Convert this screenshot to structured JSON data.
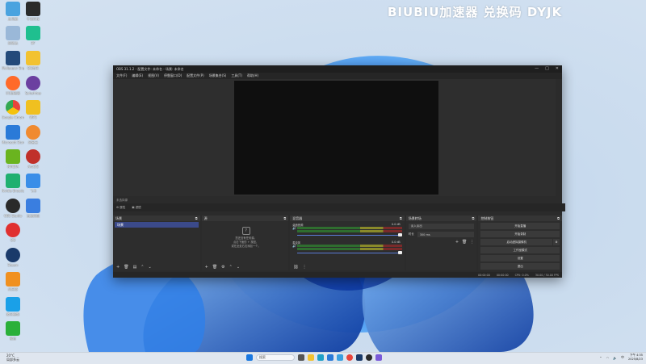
{
  "watermark": "BIUBIU加速器 兑换码 DYJK",
  "desktop_icons": [
    {
      "label": "此电脑",
      "color": "#4aa3df"
    },
    {
      "label": "牛客科技",
      "color": "#2b2b2b"
    },
    {
      "label": "回收站",
      "color": "#9ab8d8"
    },
    {
      "label": "BF",
      "color": "#1fbf8f"
    },
    {
      "label": "Wallpaper Engine",
      "color": "#244a7a"
    },
    {
      "label": "QQ音乐",
      "color": "#f2c230"
    },
    {
      "label": "UU加速器",
      "color": "#ff6a2a"
    },
    {
      "label": "Splashtop",
      "color": "#6b3fa0"
    },
    {
      "label": "Google Chrome",
      "color": "#e8453c"
    },
    {
      "label": "WPS",
      "color": "#f0c020"
    },
    {
      "label": "Microsoft Store",
      "color": "#2a7ad8"
    },
    {
      "label": "网易云",
      "color": "#f08a30"
    },
    {
      "label": "NVIDIA",
      "color": "#6ab41f"
    },
    {
      "label": "ArcGIS",
      "color": "#c0302a"
    },
    {
      "label": "Nvidia Broadcast",
      "color": "#20b070"
    },
    {
      "label": "飞书",
      "color": "#3a8ee8"
    },
    {
      "label": "OBS Studio",
      "color": "#2a2a2a"
    },
    {
      "label": "百度网盘",
      "color": "#3a7ee0"
    },
    {
      "label": "QQ",
      "color": "#e03030"
    },
    {
      "label": "Steam",
      "color": "#1a3a6a"
    },
    {
      "label": "向日葵",
      "color": "#f09020"
    },
    {
      "label": "腾讯视频",
      "color": "#1aa0e8"
    },
    {
      "label": "微信",
      "color": "#2ab03a"
    }
  ],
  "obs": {
    "title": "OBS 31.1.2 - 配置文件: 未命名 - 场景: 未命名",
    "window_controls": [
      "—",
      "□",
      "✕"
    ],
    "menu": [
      "文件(F)",
      "编辑(E)",
      "视图(V)",
      "停靠窗口(D)",
      "配置文件(P)",
      "场景集合(S)",
      "工具(T)",
      "帮助(H)"
    ],
    "source_bar": "未选择源",
    "toolbar": {
      "properties": "属性",
      "filters": "滤镜"
    },
    "scenes": {
      "title": "场景",
      "items": [
        "场景"
      ]
    },
    "sources": {
      "title": "源",
      "empty_line1": "您还没有任何源。",
      "empty_line2": "点击下面的 + 按钮，",
      "empty_line3": "或在此处右击添加一个。"
    },
    "mixer": {
      "title": "混音器",
      "rows": [
        {
          "name": "桌面音频",
          "db": "0.0 dB"
        },
        {
          "name": "麦克风",
          "db": "0.0 dB"
        }
      ]
    },
    "transitions": {
      "title": "场景转场",
      "type": "淡入淡出",
      "duration_label": "时长",
      "duration": "300 ms"
    },
    "controls": {
      "title": "控制按钮",
      "buttons": [
        "开始直播",
        "开始录制",
        "启动虚拟摄像机",
        "工作室模式",
        "设置",
        "退出"
      ]
    },
    "status": {
      "cpu": "CPU: 0.0%",
      "fps": "30.00 / 30.00 FPS",
      "time1": "00:00:00",
      "time2": "00:00:00"
    }
  },
  "taskbar": {
    "weather_temp": "20°C",
    "weather_desc": "局部多云",
    "search_placeholder": "搜索",
    "clock_time": "下午 4:35",
    "clock_date": "2025/8/23",
    "lang": "中"
  }
}
